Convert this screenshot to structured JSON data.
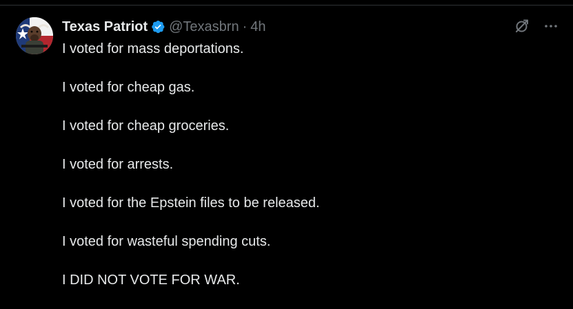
{
  "tweet": {
    "author": {
      "display_name": "Texas Patriot",
      "handle": "@Texasbrn",
      "verified": true,
      "avatar_icon": "longhorn-texas-flag-avatar"
    },
    "separator": "·",
    "timestamp": "4h",
    "lines": [
      "I voted for mass deportations.",
      "I voted for cheap gas.",
      "I voted for cheap groceries.",
      "I voted for arrests.",
      "I voted for the Epstein files to be released.",
      "I voted for wasteful spending cuts.",
      "I DID NOT VOTE FOR WAR."
    ],
    "actions": {
      "grok_icon": "grok-icon",
      "more_icon": "more-options-icon"
    }
  },
  "colors": {
    "background": "#000000",
    "text_primary": "#e7e9ea",
    "text_secondary": "#71767b",
    "verified_blue": "#1d9bf0",
    "divider": "#2f3336"
  }
}
